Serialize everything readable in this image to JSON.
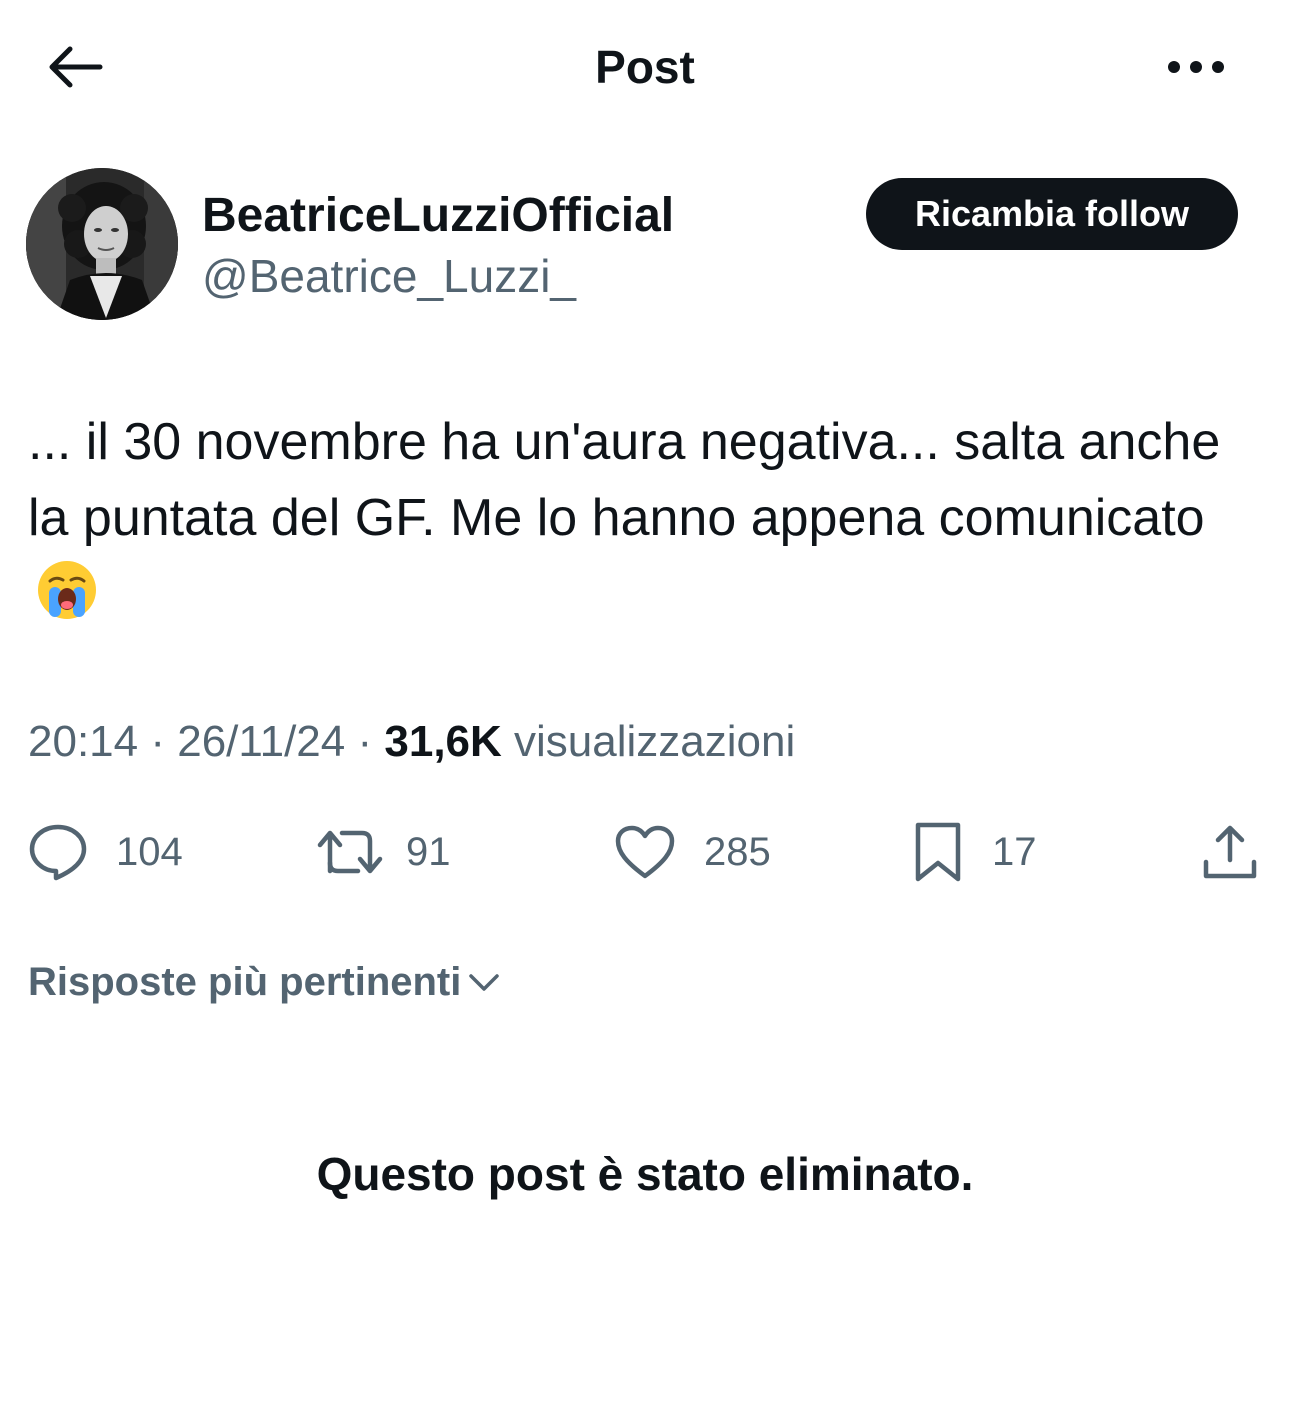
{
  "header": {
    "title": "Post",
    "back_icon": "arrow-left-icon",
    "more_icon": "more-horizontal-icon"
  },
  "author": {
    "display_name": "BeatriceLuzziOfficial",
    "handle": "@Beatrice_Luzzi_",
    "follow_label": "Ricambia follow",
    "avatar_icon": "avatar-photo"
  },
  "post": {
    "text": "... il 30 novembre ha un'aura negativa... salta anche la puntata del GF. Me lo hanno appena comunicato",
    "emoji_icon": "loudly-crying-face-emoji"
  },
  "meta": {
    "time": "20:14",
    "separator": "·",
    "date": "26/11/24",
    "views_count": "31,6K",
    "views_label": "visualizzazioni"
  },
  "actions": {
    "replies": "104",
    "reposts": "91",
    "likes": "285",
    "bookmarks": "17",
    "reply_icon": "reply-icon",
    "repost_icon": "repost-icon",
    "like_icon": "heart-icon",
    "bookmark_icon": "bookmark-icon",
    "share_icon": "share-icon"
  },
  "replies_section": {
    "sort_label": "Risposte più pertinenti",
    "sort_icon": "chevron-down-icon",
    "deleted_notice": "Questo post è stato eliminato."
  },
  "colors": {
    "text_primary": "#0f1419",
    "text_secondary": "#536471",
    "button_bg": "#0f1419",
    "background": "#ffffff"
  }
}
